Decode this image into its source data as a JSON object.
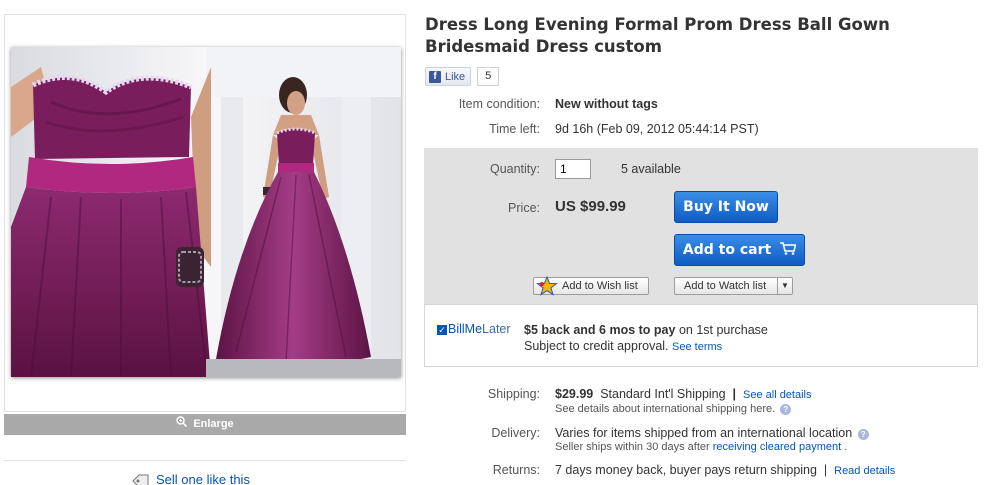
{
  "listing": {
    "title": "Dress Long Evening Formal Prom Dress Ball Gown Bridesmaid Dress custom"
  },
  "left": {
    "enlarge_label": "Enlarge",
    "sell_one_label": "Sell one like this"
  },
  "facebook": {
    "like_label": "Like",
    "like_count": "5"
  },
  "details": {
    "condition_label": "Item condition:",
    "condition_value": "New without tags",
    "time_left_label": "Time left:",
    "time_left_value": "9d 16h (Feb 09, 2012  05:44:14 PST)"
  },
  "buybox": {
    "quantity_label": "Quantity:",
    "quantity_value": "1",
    "available_text": "5 available",
    "price_label": "Price:",
    "price_value": "US $99.99",
    "buy_now_label": "Buy It Now",
    "add_to_cart_label": "Add to cart",
    "wish_list_label": "Add to Wish list",
    "watch_list_label": "Add to Watch list"
  },
  "billmelater": {
    "logo_bill": "BillMe",
    "logo_later": "Later",
    "offer_text": "$5 back and 6 mos to pay",
    "offer_suffix": "on 1st purchase",
    "subject_text": "Subject to credit approval.",
    "see_terms_label": "See terms"
  },
  "shipping": {
    "shipping_label": "Shipping:",
    "shipping_cost": "$29.99",
    "shipping_service": "Standard Int'l Shipping",
    "see_all_details_label": "See all details",
    "international_note": "See details about international shipping here.",
    "delivery_label": "Delivery:",
    "delivery_value": "Varies for items shipped from an international location",
    "seller_ships_text": "Seller ships within 30 days after",
    "receiving_payment_label": "receiving cleared payment",
    "returns_label": "Returns:",
    "returns_value": "7 days money back, buyer pays return shipping",
    "read_details_label": "Read details"
  },
  "colors": {
    "link": "#0654ba",
    "buy_button": "#1c6fd6",
    "buybox_bg": "#e1e1e1",
    "dress_purple": "#7a1d5c",
    "sash_magenta": "#b0287f"
  },
  "icons": {
    "enlarge": "magnifier-icon",
    "cart": "shopping-cart-icon",
    "wish": "star-icon",
    "watch_dropdown": "chevron-down-icon",
    "help": "question-mark-icon",
    "sell": "tag-icon"
  }
}
